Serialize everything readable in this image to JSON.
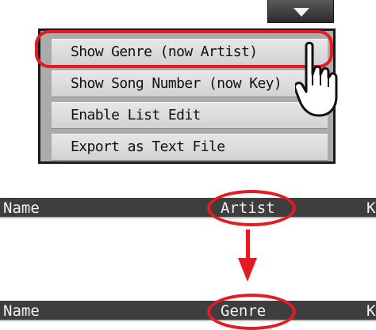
{
  "menu": {
    "items": [
      {
        "label": "Show Genre (now Artist)"
      },
      {
        "label": "Show Song Number (now Key)"
      },
      {
        "label": "Enable List Edit"
      },
      {
        "label": "Export as Text File"
      }
    ]
  },
  "header_before": {
    "name": "Name",
    "middle": "Artist",
    "right": "K"
  },
  "header_after": {
    "name": "Name",
    "middle": "Genre",
    "right": "K"
  },
  "colors": {
    "highlight": "#e31b23",
    "header_bg": "#3e3e3e",
    "menu_bg": "#ababab"
  }
}
